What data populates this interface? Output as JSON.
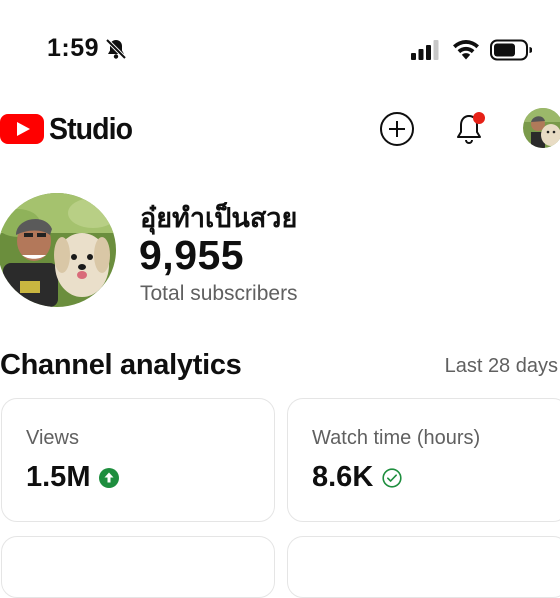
{
  "status_bar": {
    "time": "1:59",
    "icons": [
      "bell-slash-icon",
      "cellular-signal-icon",
      "wifi-icon",
      "battery-icon"
    ]
  },
  "header": {
    "logo_text": "Studio",
    "brand_color": "#ff0000",
    "buttons": [
      "create-plus-icon",
      "notifications-bell-icon",
      "account-avatar"
    ],
    "notification_dot_color": "#e62117"
  },
  "channel": {
    "name": "อุ๋ยทำเป็นสวย",
    "subscribers": "9,955",
    "subscribers_label": "Total subscribers"
  },
  "analytics": {
    "title": "Channel analytics",
    "period": "Last 28 days",
    "cards": [
      {
        "label": "Views",
        "value": "1.5M",
        "icon": "arrow-up-circle-icon",
        "icon_color": "#1e8e3e"
      },
      {
        "label": "Watch time (hours)",
        "value": "8.6K",
        "icon": "check-circle-icon",
        "icon_color": "#1e8e3e"
      }
    ]
  }
}
